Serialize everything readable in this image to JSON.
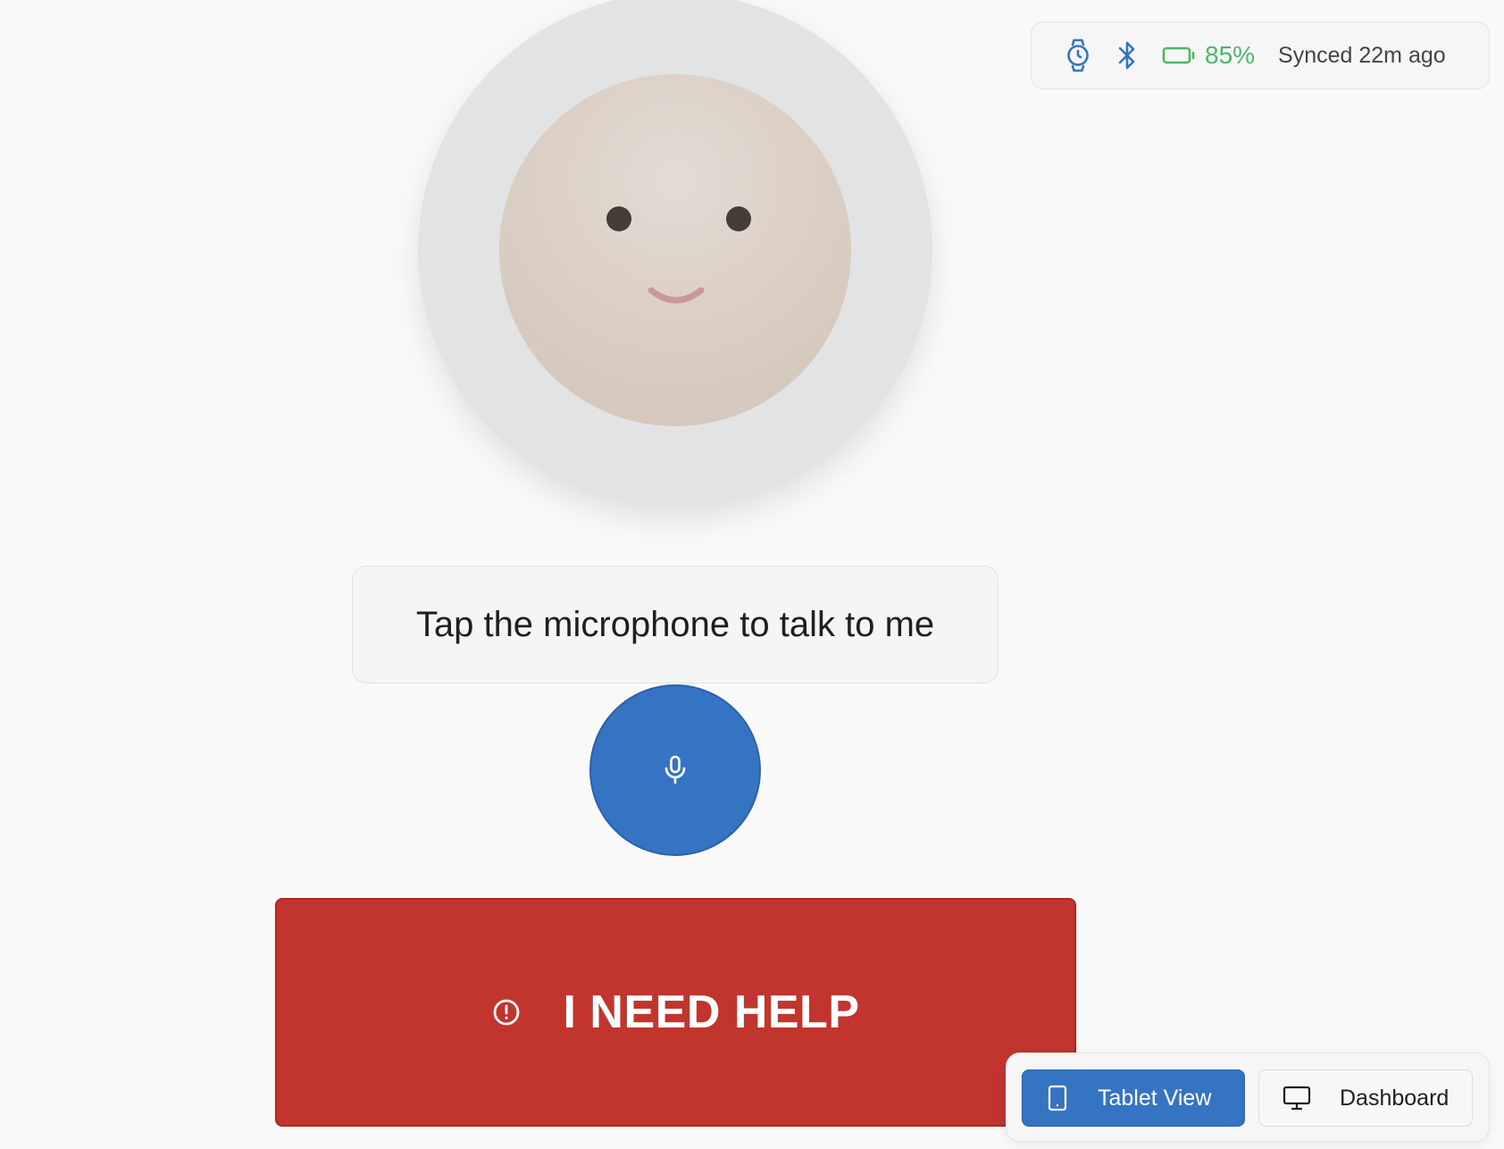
{
  "status": {
    "watch_icon": "smartwatch-icon",
    "bluetooth_icon": "bluetooth-icon",
    "battery_icon": "battery-icon",
    "battery_level": "85%",
    "sync_status": "Synced 22m ago",
    "colors": {
      "accent": "#3573c3",
      "battery": "#4cb867"
    }
  },
  "avatar": {
    "expression": "smile"
  },
  "prompt": {
    "text": "Tap the microphone to talk to me"
  },
  "mic": {
    "icon": "microphone-icon"
  },
  "help": {
    "label": "I NEED HELP",
    "icon": "alert-circle-icon",
    "color": "#c2352e"
  },
  "view_toggle": {
    "tablet_label": "Tablet View",
    "tablet_icon": "tablet-icon",
    "dashboard_label": "Dashboard",
    "dashboard_icon": "monitor-icon",
    "active": "Tablet View"
  }
}
